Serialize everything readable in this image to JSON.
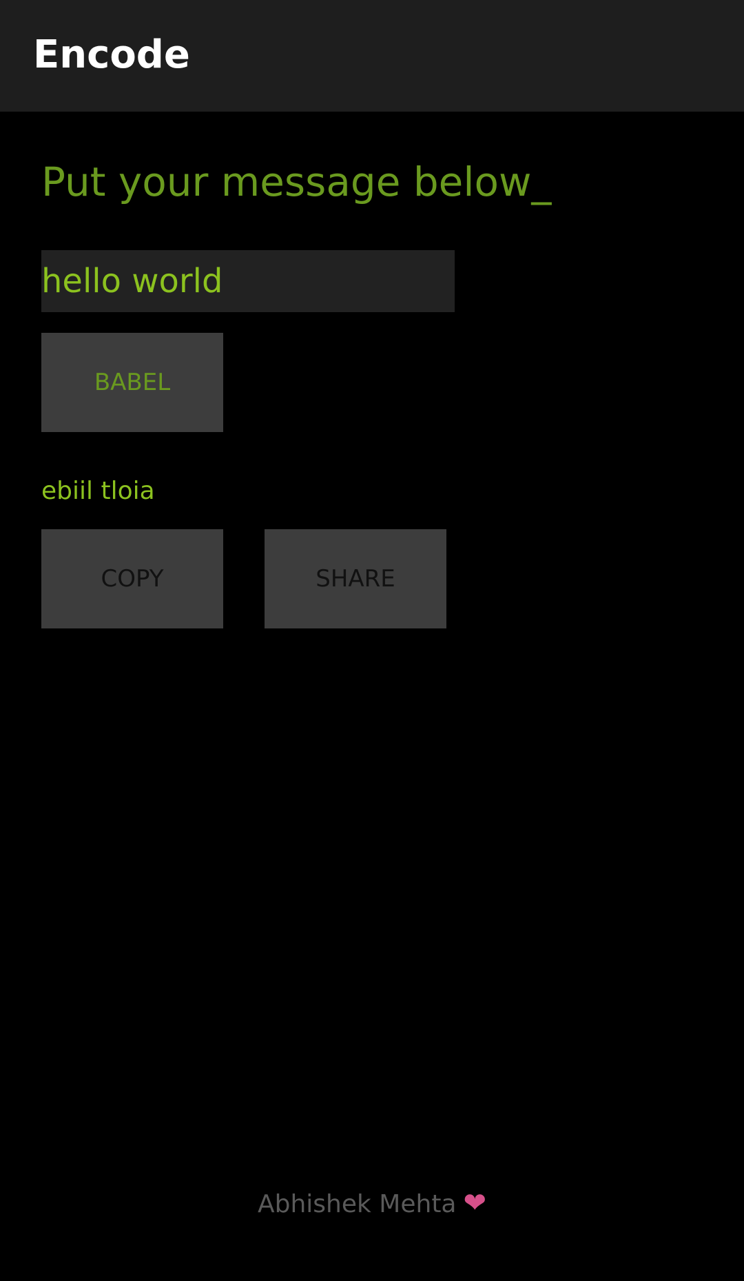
{
  "app_bar": {
    "title": "Encode"
  },
  "main": {
    "heading": "Put your message below_",
    "message_input": {
      "value": "hello world",
      "placeholder": ""
    },
    "babel_button_label": "BABEL",
    "output_text": "ebiil tloia",
    "copy_button_label": "COPY",
    "share_button_label": "SHARE"
  },
  "footer": {
    "author": "Abhishek Mehta",
    "heart_glyph": "❤",
    "heart_icon": "heart-icon"
  },
  "colors": {
    "app_bar_bg": "#1e1e1e",
    "background": "#000000",
    "accent_green": "#6a9a1f",
    "text_green": "#8cc21f",
    "button_bg": "#3d3d3d",
    "heart_pink": "#d6508a"
  }
}
